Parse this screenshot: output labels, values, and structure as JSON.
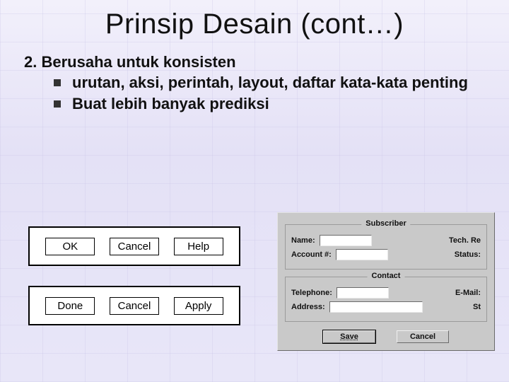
{
  "title": "Prinsip Desain (cont…)",
  "item_number": "2.",
  "item_text": "Berusaha untuk konsisten",
  "bullets": [
    "urutan, aksi, perintah, layout, daftar kata-kata penting",
    "Buat lebih banyak prediksi"
  ],
  "panels": {
    "a": {
      "ok": "OK",
      "cancel": "Cancel",
      "help": "Help"
    },
    "b": {
      "done": "Done",
      "cancel": "Cancel",
      "apply": "Apply"
    }
  },
  "dialog": {
    "subscriber": {
      "legend": "Subscriber",
      "name_label": "Name:",
      "tech_label": "Tech. Re",
      "account_label": "Account #:",
      "status_label": "Status:"
    },
    "contact": {
      "legend": "Contact",
      "telephone_label": "Telephone:",
      "email_label": "E-Mail:",
      "address_label": "Address:",
      "st_label": "St"
    },
    "save": "Save",
    "cancel": "Cancel"
  }
}
